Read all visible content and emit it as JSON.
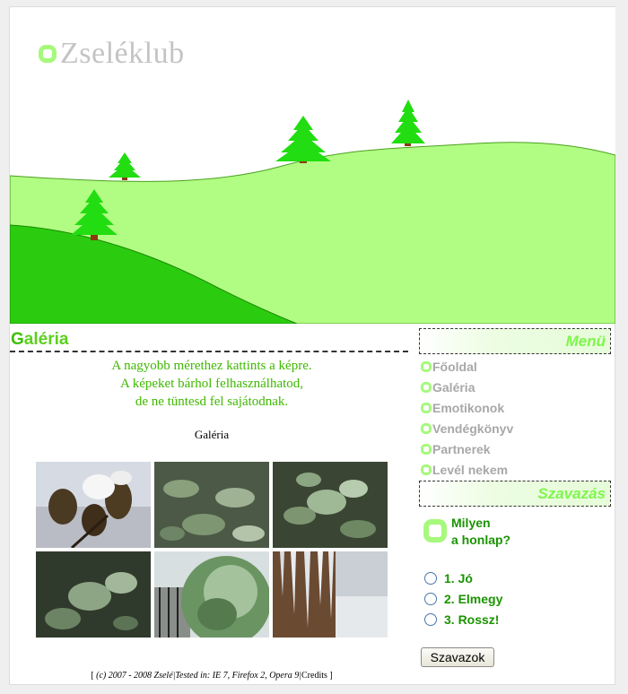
{
  "site": {
    "logo_text": "Zseléklub"
  },
  "main": {
    "title_first": "G",
    "title_rest": "aléria",
    "intro_lines": [
      "A nagyobb mérethez kattints a képre.",
      "A képeket bárhol felhasználhatod,",
      "de ne tüntesd fel sajátodnak."
    ],
    "gallery_caption": "Galéria",
    "thumbnails": [
      {
        "subject": "frozen-seed-pods"
      },
      {
        "subject": "iced-bush-leaves"
      },
      {
        "subject": "iced-leaf-cluster"
      },
      {
        "subject": "frozen-leaves-closeup"
      },
      {
        "subject": "iced-conifer-fence"
      },
      {
        "subject": "icicles-wall"
      }
    ]
  },
  "sidebar": {
    "menu_title": "Menü",
    "menu_items": [
      "Főoldal",
      "Galéria",
      "Emotikonok",
      "Vendégkönyv",
      "Partnerek",
      "Levél nekem"
    ],
    "poll_title": "Szavazás",
    "poll_question_line1": "Milyen",
    "poll_question_line2": "a honlap?",
    "poll_options": [
      "1. Jó",
      "2. Elmegy",
      "3. Rossz!"
    ],
    "vote_button": "Szavazok"
  },
  "footer": {
    "open_bracket": "[",
    "text_main": "(c) 2007 - 2008 Zselé|Tested in: IE 7, Firefox 2, Opera 9|",
    "credits_link": "Credits",
    "close_bracket": "]"
  },
  "colors": {
    "accent_green": "#a6f97b",
    "hill_green": "#b1fd83",
    "title_green": "#5cd01e",
    "poll_green": "#1a9400",
    "menu_gray": "#a8a8a8"
  }
}
